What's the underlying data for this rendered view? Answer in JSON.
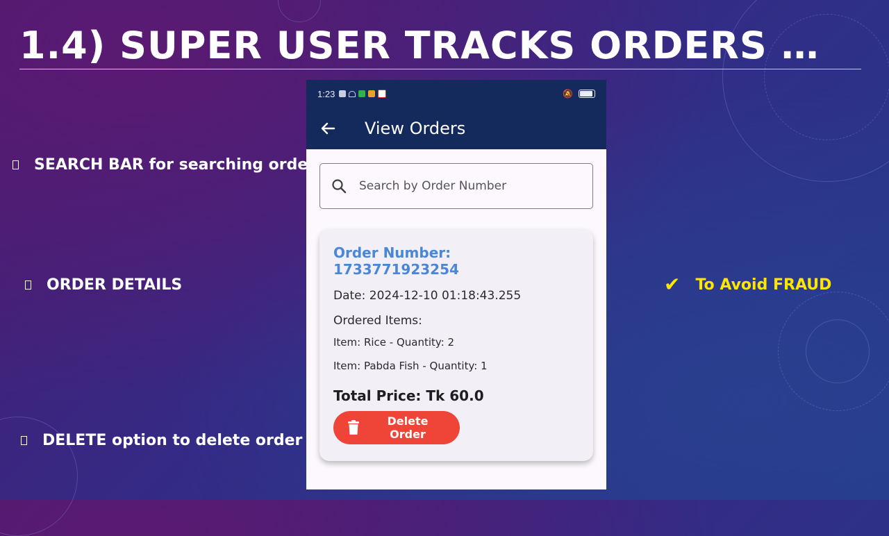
{
  "slide": {
    "title": "1.4) SUPER USER TRACKS ORDERS …",
    "bullets": [
      "SEARCH BAR for searching order",
      "ORDER DETAILS",
      "DELETE option to delete order"
    ],
    "note": {
      "check": "✔",
      "text": "To Avoid FRAUD",
      "color": "#ffe600"
    }
  },
  "phone": {
    "status_time": "1:23",
    "appbar_title": "View Orders",
    "back_icon": "arrow-left-icon",
    "search": {
      "placeholder": "Search by Order Number",
      "icon": "search-icon"
    },
    "order": {
      "number_label": "Order Number: 1733771923254",
      "date_label": "Date: 2024-12-10 01:18:43.255",
      "ordered_items_label": "Ordered Items:",
      "items": [
        "Item: Rice - Quantity: 2",
        "Item: Pabda Fish - Quantity: 1"
      ],
      "total_label": "Total Price: Tk 60.0",
      "delete_label": "Delete Order",
      "delete_icon": "trash-icon"
    },
    "colors": {
      "appbar": "#152a5c",
      "order_number": "#4a87d6",
      "delete_button": "#ef4438"
    }
  }
}
